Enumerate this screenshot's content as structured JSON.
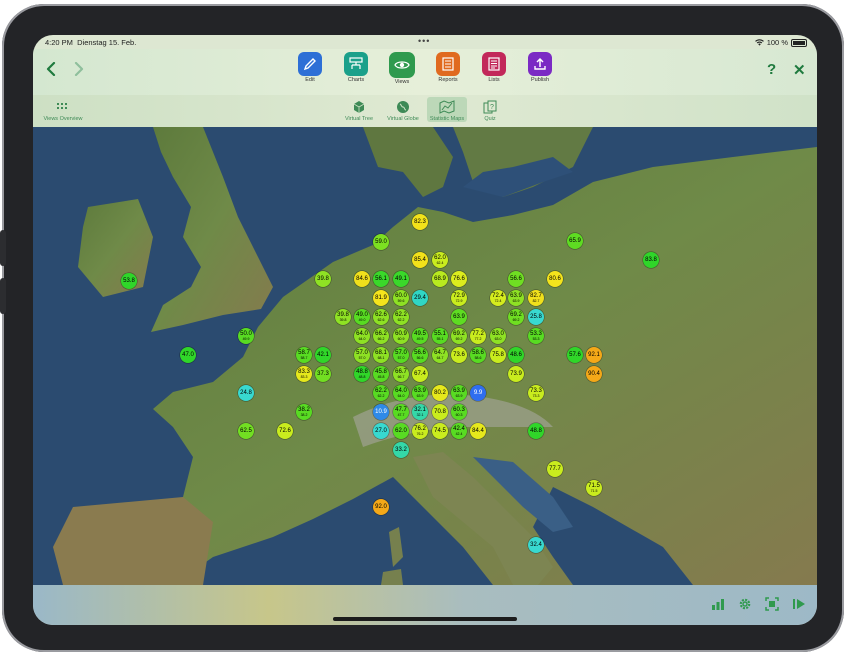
{
  "status_bar": {
    "time": "4:20 PM",
    "date": "Dienstag 15. Feb.",
    "more": "•••",
    "battery": "100 %"
  },
  "toolbar": {
    "tools": [
      {
        "name": "edit",
        "label": "Edit",
        "color": "#2d6fd6"
      },
      {
        "name": "charts",
        "label": "Charts",
        "color": "#1aa08a"
      },
      {
        "name": "views",
        "label": "Views",
        "color": "#2f9a4e",
        "active": true
      },
      {
        "name": "reports",
        "label": "Reports",
        "color": "#e06a1f"
      },
      {
        "name": "lists",
        "label": "Lists",
        "color": "#c2285a"
      },
      {
        "name": "publish",
        "label": "Publish",
        "color": "#7b2ac4"
      }
    ],
    "help_label": "?",
    "close_label": "✕"
  },
  "subbar": {
    "overview_label": "Views Overview",
    "items": [
      {
        "name": "virtual-tree",
        "label": "Virtual Tree"
      },
      {
        "name": "virtual-globe",
        "label": "Virtual Globe"
      },
      {
        "name": "statistic-maps",
        "label": "Statistic Maps",
        "active": true
      },
      {
        "name": "quiz",
        "label": "Quiz"
      }
    ]
  },
  "map": {
    "markers": [
      {
        "value": "82.3",
        "color": "#f2e21a"
      },
      {
        "value": "59.0",
        "color": "#7ce021"
      },
      {
        "value": "65.9",
        "color": "#5edc22"
      },
      {
        "value": "83.8",
        "color": "#2fd629"
      },
      {
        "value": "53.8",
        "color": "#2fd629"
      },
      {
        "value": "85.4",
        "color": "#f2e21a"
      },
      {
        "value": "62.0",
        "color": "#c9ec1e",
        "sub": "62.4"
      },
      {
        "value": "84.6",
        "color": "#f0e01c"
      },
      {
        "value": "56.1",
        "color": "#3ad82a"
      },
      {
        "value": "49.1",
        "color": "#3ad82a"
      },
      {
        "value": "39.8",
        "color": "#8fe224"
      },
      {
        "value": "68.9",
        "color": "#b8ea1f"
      },
      {
        "value": "76.6",
        "color": "#dced1e"
      },
      {
        "value": "56.6",
        "color": "#6fde22"
      },
      {
        "value": "80.6",
        "color": "#f4e41c"
      },
      {
        "value": "81.9",
        "color": "#f4e41c"
      },
      {
        "value": "60.0",
        "color": "#8ee124",
        "sub": "59.6"
      },
      {
        "value": "29.4",
        "color": "#30d6c4"
      },
      {
        "value": "72.9",
        "color": "#c9ec1e",
        "sub": "72.9"
      },
      {
        "value": "72.4",
        "color": "#d5ec1e",
        "sub": "72.4"
      },
      {
        "value": "63.9",
        "color": "#8ee124",
        "sub": "63.9"
      },
      {
        "value": "82.7",
        "color": "#f0e01c",
        "sub": "82.7"
      },
      {
        "value": "39.8",
        "color": "#8fe224",
        "sub": "39.8"
      },
      {
        "value": "49.0",
        "color": "#58db22",
        "sub": "49.0"
      },
      {
        "value": "62.6",
        "color": "#8ee124",
        "sub": "62.6"
      },
      {
        "value": "62.2",
        "color": "#8ee124",
        "sub": "62.2"
      },
      {
        "value": "63.9",
        "color": "#5edc22"
      },
      {
        "value": "69.2",
        "color": "#6fde22",
        "sub": "69.2"
      },
      {
        "value": "25.8",
        "color": "#38d9d0"
      },
      {
        "value": "64.0",
        "color": "#8ee124",
        "sub": "64.0"
      },
      {
        "value": "66.2",
        "color": "#8ee124",
        "sub": "66.2"
      },
      {
        "value": "60.9",
        "color": "#8ee124",
        "sub": "60.9"
      },
      {
        "value": "49.5",
        "color": "#58db22",
        "sub": "49.5"
      },
      {
        "value": "55.1",
        "color": "#58db22",
        "sub": "55.1"
      },
      {
        "value": "69.2",
        "color": "#8ee124",
        "sub": "69.2"
      },
      {
        "value": "77.2",
        "color": "#c9ec1e",
        "sub": "77.2"
      },
      {
        "value": "63.0",
        "color": "#8ee124",
        "sub": "63.0"
      },
      {
        "value": "53.3",
        "color": "#58db22",
        "sub": "53.3"
      },
      {
        "value": "50.0",
        "color": "#58db22",
        "sub": "49.9"
      },
      {
        "value": "57.0",
        "color": "#8ee124",
        "sub": "57.0"
      },
      {
        "value": "68.1",
        "color": "#8ee124",
        "sub": "68.1"
      },
      {
        "value": "57.0",
        "color": "#58db22",
        "sub": "57.0"
      },
      {
        "value": "56.6",
        "color": "#58db22",
        "sub": "56.6"
      },
      {
        "value": "64.7",
        "color": "#8ee124",
        "sub": "64.7"
      },
      {
        "value": "73.6",
        "color": "#c9ec1e"
      },
      {
        "value": "58.6",
        "color": "#58db22",
        "sub": "58.6"
      },
      {
        "value": "75.8",
        "color": "#c9ec1e"
      },
      {
        "value": "48.6",
        "color": "#30d629"
      },
      {
        "value": "57.6",
        "color": "#30d629"
      },
      {
        "value": "92.1",
        "color": "#f4a818"
      },
      {
        "value": "47.0",
        "color": "#30d629"
      },
      {
        "value": "58.7",
        "color": "#58db22",
        "sub": "58.7"
      },
      {
        "value": "42.1",
        "color": "#30d629"
      },
      {
        "value": "83.3",
        "color": "#e6e81c",
        "sub": "83.3"
      },
      {
        "value": "37.3",
        "color": "#72df22"
      },
      {
        "value": "48.8",
        "color": "#30d629",
        "sub": "48.8"
      },
      {
        "value": "45.8",
        "color": "#58db22",
        "sub": "45.8"
      },
      {
        "value": "66.7",
        "color": "#8ee124",
        "sub": "66.7"
      },
      {
        "value": "67.4",
        "color": "#c9ec1e"
      },
      {
        "value": "73.9",
        "color": "#c9ec1e"
      },
      {
        "value": "90.4",
        "color": "#f4a818"
      },
      {
        "value": "24.8",
        "color": "#38d9d0"
      },
      {
        "value": "62.2",
        "color": "#58db22",
        "sub": "62.2"
      },
      {
        "value": "64.0",
        "color": "#58db22",
        "sub": "64.0"
      },
      {
        "value": "63.9",
        "color": "#58db22",
        "sub": "63.9"
      },
      {
        "value": "80.2",
        "color": "#e6e81c"
      },
      {
        "value": "63.9",
        "color": "#58db22",
        "sub": "63.9"
      },
      {
        "value": "9.9",
        "color": "#2f6ef0"
      },
      {
        "value": "73.3",
        "color": "#c9ec1e",
        "sub": "73.3"
      },
      {
        "value": "38.2",
        "color": "#58db22",
        "sub": "38.2"
      },
      {
        "value": "10.9",
        "color": "#2f8ae8"
      },
      {
        "value": "47.7",
        "color": "#58db22",
        "sub": "47.7"
      },
      {
        "value": "32.1",
        "color": "#34d8a8",
        "sub": "32.1"
      },
      {
        "value": "70.8",
        "color": "#c9ec1e"
      },
      {
        "value": "60.3",
        "color": "#58db22",
        "sub": "60.3"
      },
      {
        "value": "62.5",
        "color": "#72df22"
      },
      {
        "value": "72.6",
        "color": "#c9ec1e"
      },
      {
        "value": "27.0",
        "color": "#38d9d0"
      },
      {
        "value": "62.0",
        "color": "#58db22"
      },
      {
        "value": "76.2",
        "color": "#c9ec1e",
        "sub": "76.2"
      },
      {
        "value": "74.5",
        "color": "#c9ec1e"
      },
      {
        "value": "42.4",
        "color": "#58db22",
        "sub": "42.4"
      },
      {
        "value": "84.4",
        "color": "#e6e81c"
      },
      {
        "value": "48.8",
        "color": "#30d629"
      },
      {
        "value": "33.2",
        "color": "#34d8a8"
      },
      {
        "value": "77.7",
        "color": "#c9ec1e"
      },
      {
        "value": "71.5",
        "color": "#c9ec1e",
        "sub": "71.5"
      },
      {
        "value": "92.0",
        "color": "#f4a818"
      },
      {
        "value": "32.4",
        "color": "#38d9d0"
      }
    ]
  },
  "bottom_bar": {
    "icons": [
      "bar-chart-icon",
      "gear-icon",
      "fit-screen-icon",
      "play-icon"
    ],
    "icon_color": "#2f9a4e"
  }
}
